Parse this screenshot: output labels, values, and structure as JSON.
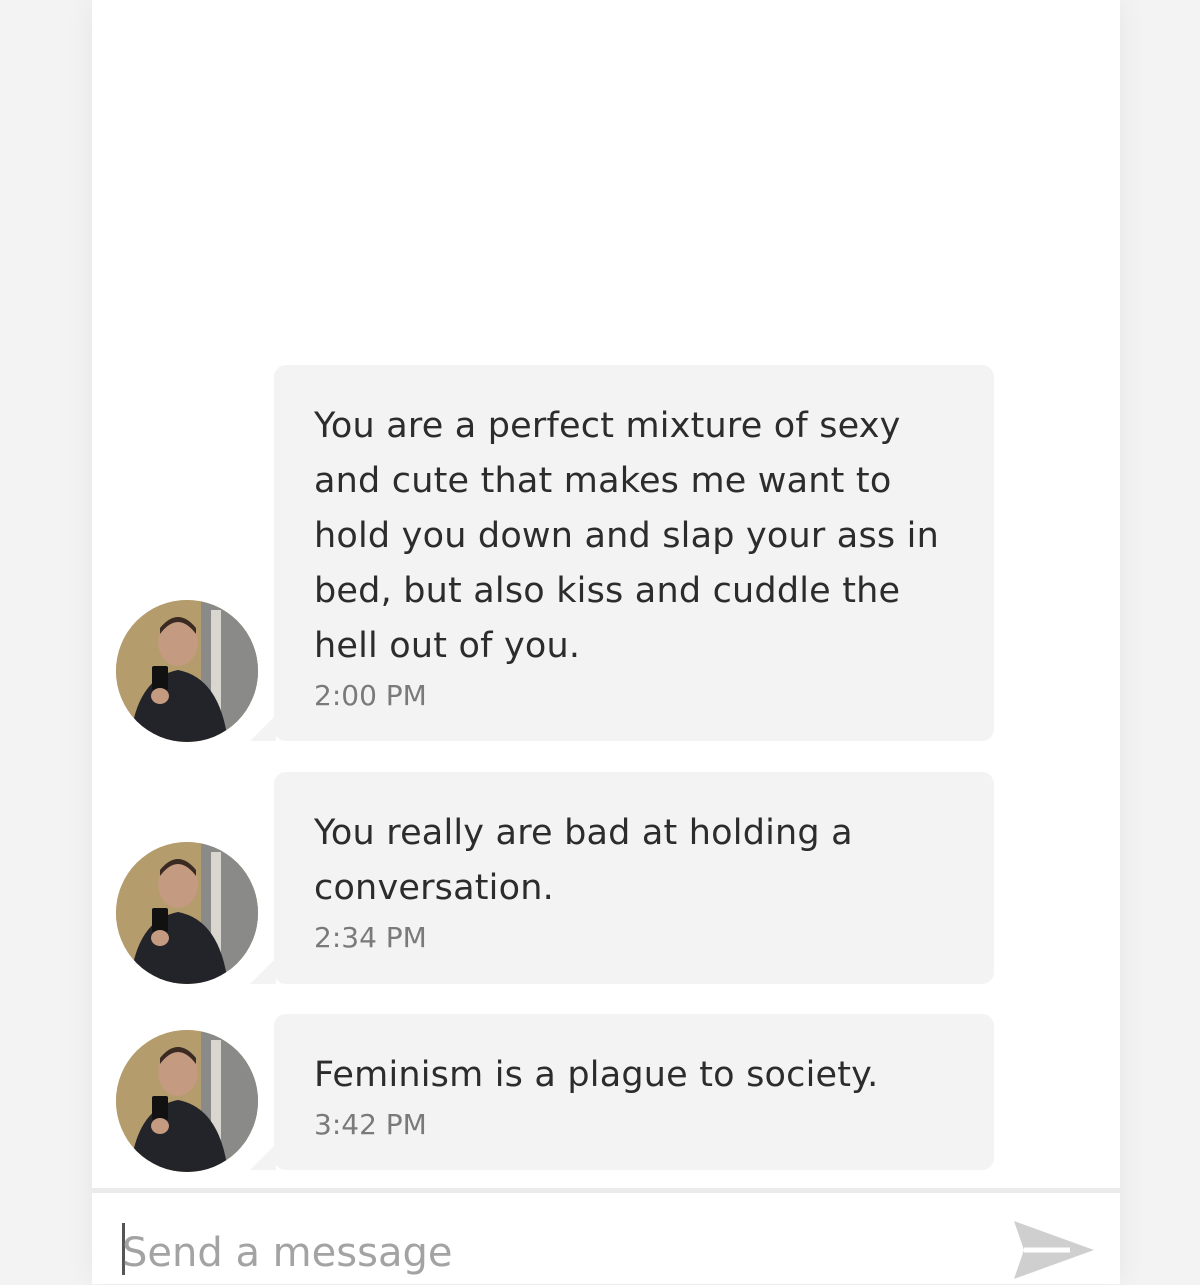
{
  "messages": [
    {
      "text": "You are a perfect mixture of sexy and cute that makes me want to hold you down and slap your ass in bed, but also kiss and cuddle the hell out of you.",
      "time": "2:00 PM"
    },
    {
      "text": "You really are bad at holding a conversation.",
      "time": "2:34 PM"
    },
    {
      "text": "Feminism is a plague to society.",
      "time": "3:42 PM"
    }
  ],
  "composer": {
    "placeholder": "Send a message",
    "send_icon": "send-arrow-icon"
  },
  "colors": {
    "bubble_bg": "#f3f3f3",
    "message_text": "#2c2c2c",
    "timestamp": "#7a7a7a",
    "placeholder": "#a3a3a3",
    "send_icon": "#cfcfcf"
  }
}
